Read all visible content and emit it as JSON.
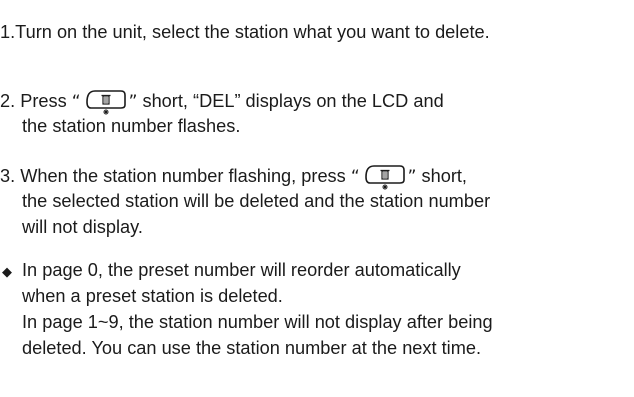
{
  "step1": {
    "text": "1.Turn on the unit, select the station what you want to delete."
  },
  "step2": {
    "prefix": "2. Press",
    "open_quote": "“",
    "close_quote": "”",
    "suffix": "short, “DEL” displays on the LCD and",
    "line2": "the station number flashes."
  },
  "step3": {
    "prefix": "3. When the station number flashing, press",
    "open_quote": "“",
    "close_quote": "”",
    "suffix": "short,",
    "line2": "the selected station will be deleted and the station number",
    "line3": "will not display."
  },
  "note": {
    "bullet": "◆",
    "line1": "In page 0, the preset number will reorder automatically",
    "line2": "when a preset station is deleted.",
    "line3": "In page 1~9, the station number will not display after being",
    "line4": "deleted. You can use the station number at the next time."
  },
  "icons": {
    "delete_button": "delete-button-icon",
    "trash": "trash-icon",
    "light": "light-icon"
  }
}
